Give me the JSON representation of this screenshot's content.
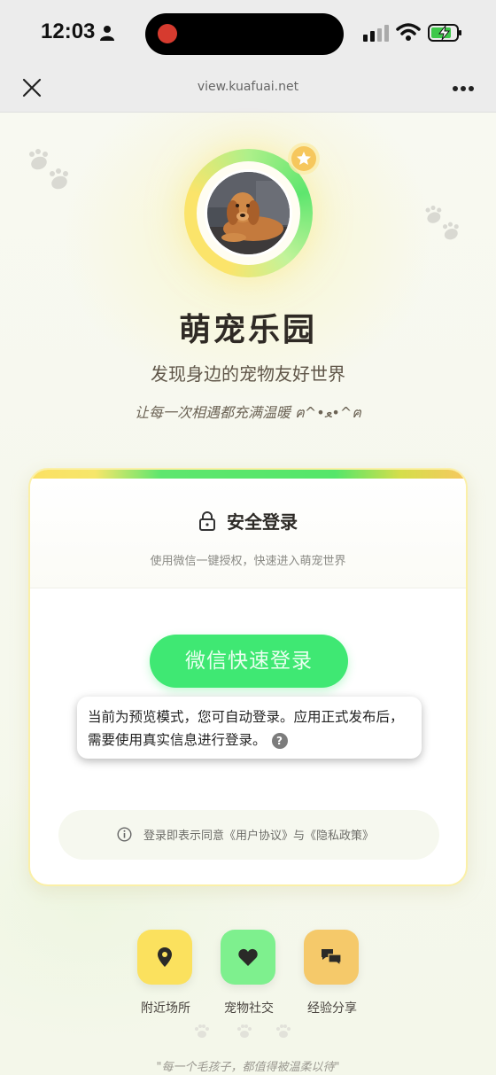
{
  "status_bar": {
    "time": "12:03"
  },
  "browser": {
    "url": "view.kuafuai.net"
  },
  "header": {
    "title": "萌宠乐园",
    "subtitle": "发现身边的宠物友好世界",
    "tagline": "让每一次相遇都充满温暖 ฅ^•ﻌ•^ฅ"
  },
  "login_card": {
    "title": "安全登录",
    "description": "使用微信一键授权，快速进入萌宠世界",
    "wechat_button": "微信快速登录",
    "tooltip": "当前为预览模式，您可自动登录。应用正式发布后，需要使用真实信息进行登录。",
    "help_symbol": "?",
    "agreement": "登录即表示同意《用户协议》与《隐私政策》"
  },
  "features": [
    {
      "label": "附近场所",
      "icon": "location-pin-icon",
      "color": "#fbe15e"
    },
    {
      "label": "宠物社交",
      "icon": "heart-icon",
      "color": "#7ef08e"
    },
    {
      "label": "经验分享",
      "icon": "chat-bubbles-icon",
      "color": "#f5c96a"
    }
  ],
  "footer": {
    "quote": "\"每一个毛孩子，都值得被温柔以待\""
  },
  "colors": {
    "accent_green": "#3fe873",
    "accent_yellow": "#fbe15e",
    "accent_orange": "#f5c96a"
  }
}
